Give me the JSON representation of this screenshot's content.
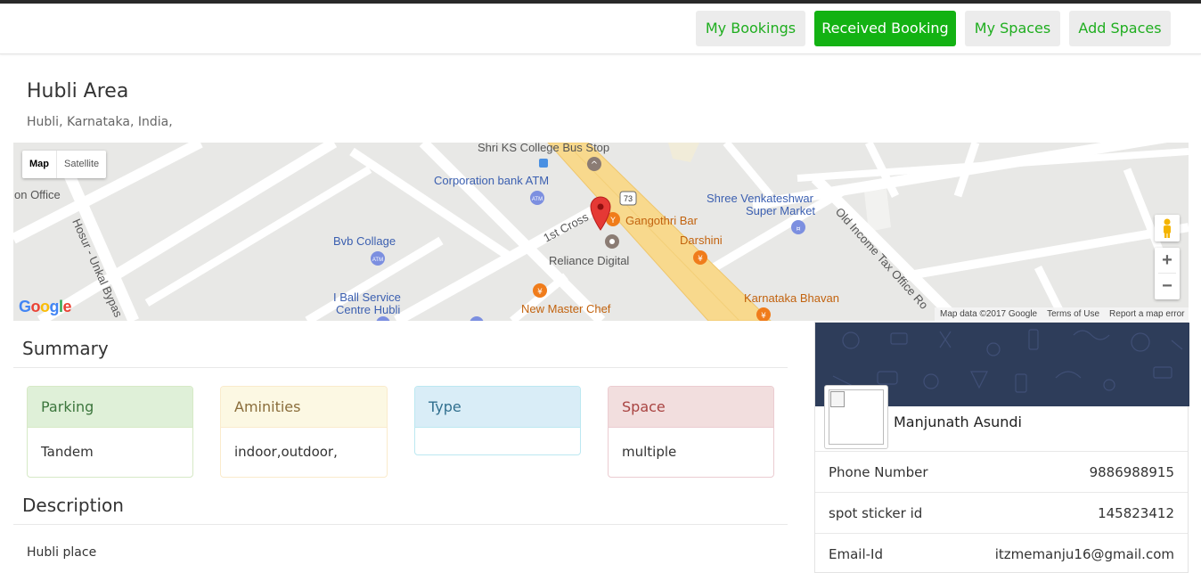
{
  "nav": {
    "my_bookings": "My Bookings",
    "received_booking": "Received Booking",
    "my_spaces": "My Spaces",
    "add_spaces": "Add Spaces"
  },
  "area": {
    "title": "Hubli Area",
    "address": "Hubli, Karnataka, India,"
  },
  "map": {
    "type_map": "Map",
    "type_satellite": "Satellite",
    "labels": {
      "bus_stop": "Shri KS College Bus Stop",
      "atm": "Corporation bank ATM",
      "office": "on Office",
      "road_hosur": "Hosur - Unkal Bypas",
      "college": "Bvb Collage",
      "cross": "1st Cross",
      "bar": "Gangothri Bar",
      "reliance": "Reliance Digital",
      "super_market_1": "Shree Venkateshwar",
      "super_market_2": "Super Market",
      "darshini": "Darshini",
      "road_tax": "Old Income Tax Office Ro",
      "ball_1": "I Ball Service",
      "ball_2": "Centre Hubli",
      "new_master": "New Master Chef",
      "karnataka_bhavan": "Karnataka Bhavan",
      "route_73": "73"
    },
    "google": "Google",
    "footer_data": "Map data ©2017 Google",
    "footer_terms": "Terms of Use",
    "footer_report": "Report a map error",
    "zoom_in": "+",
    "zoom_out": "−"
  },
  "summary": {
    "title": "Summary",
    "parking_head": "Parking",
    "parking_value": "Tandem",
    "amenities_head": "Aminities",
    "amenities_value": "indoor,outdoor,",
    "type_head": "Type",
    "type_value": "",
    "space_head": "Space",
    "space_value": "multiple"
  },
  "description": {
    "title": "Description",
    "text": "Hubli place"
  },
  "profile": {
    "name": "Manjunath Asundi",
    "rows": [
      {
        "label": "Phone Number",
        "value": "9886988915"
      },
      {
        "label": "spot sticker id",
        "value": "145823412"
      },
      {
        "label": "Email-Id",
        "value": "itzmemanju16@gmail.com"
      }
    ]
  },
  "colors": {
    "nav_text": "#1fae1f",
    "nav_active_bg": "#13b213",
    "map_marker": "#e53935",
    "poi_orange": "#f07c1b",
    "poi_blue": "#6b7fd6"
  },
  "icons": [
    "pegman-icon",
    "map-marker-icon",
    "atm-icon",
    "restaurant-icon",
    "bar-icon",
    "school-icon",
    "bus-icon",
    "shopping-cart-icon",
    "store-icon"
  ]
}
